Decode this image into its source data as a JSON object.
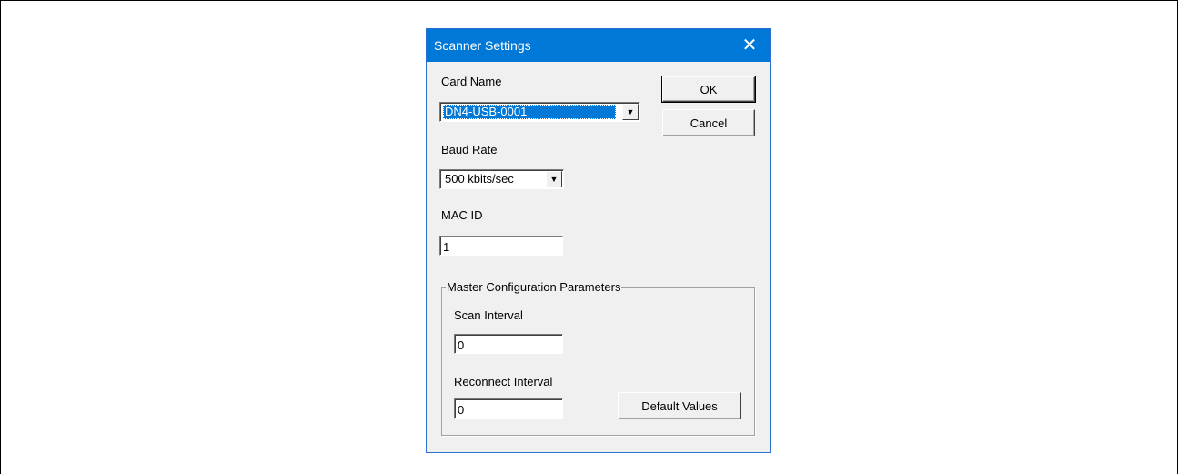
{
  "dialog": {
    "title": "Scanner Settings",
    "close_glyph": "✕"
  },
  "card_name": {
    "label": "Card Name",
    "value": "DN4-USB-0001"
  },
  "baud_rate": {
    "label": "Baud Rate",
    "value": "500 kbits/sec"
  },
  "mac_id": {
    "label": "MAC ID",
    "value": "1"
  },
  "master_config": {
    "title": "Master Configuration Parameters",
    "scan_interval_label": "Scan Interval",
    "scan_interval_value": "0",
    "reconnect_interval_label": "Reconnect Interval",
    "reconnect_interval_value": "0",
    "default_values_label": "Default Values"
  },
  "buttons": {
    "ok_label": "OK",
    "cancel_label": "Cancel"
  },
  "icons": {
    "dropdown": "▼"
  },
  "colors": {
    "titlebar": "#0078d7",
    "selection": "#0078d7",
    "dialog_bg": "#f0f0f0"
  }
}
